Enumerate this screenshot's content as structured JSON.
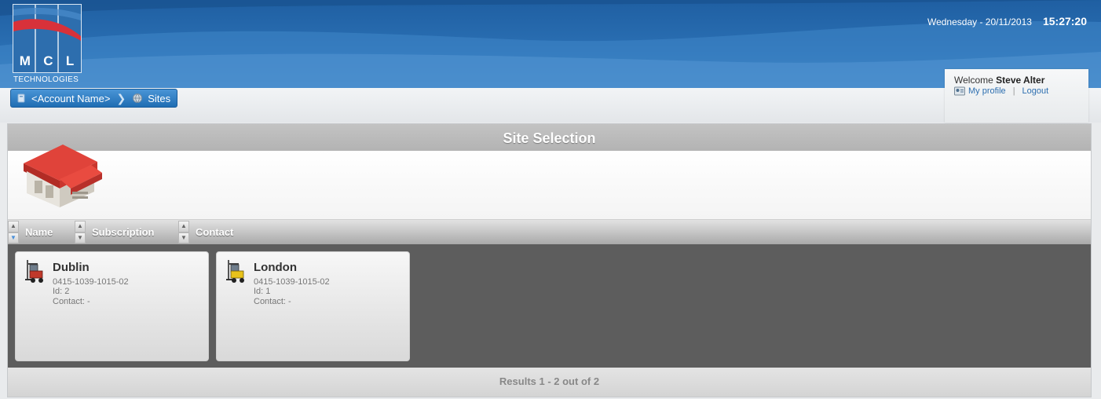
{
  "header": {
    "logo_letters": [
      "M",
      "C",
      "L"
    ],
    "logo_subtitle": "TECHNOLOGIES",
    "date": "Wednesday - 20/11/2013",
    "time": "15:27:20"
  },
  "breadcrumb": {
    "items": [
      {
        "label": "<Account Name>",
        "icon": "account-icon"
      },
      {
        "label": "Sites",
        "icon": "globe-icon"
      }
    ]
  },
  "user": {
    "welcome_prefix": "Welcome",
    "name": "Steve Alter",
    "profile_link": "My profile",
    "logout_link": "Logout"
  },
  "panel": {
    "title": "Site Selection",
    "sort_columns": [
      "Name",
      "Subscription",
      "Contact"
    ],
    "footer": "Results 1 - 2 out of 2"
  },
  "sites": [
    {
      "name": "Dublin",
      "subscription": "0415-1039-1015-02",
      "id": "Id: 2",
      "contact": "Contact: -",
      "icon": "forklift-icon",
      "accent": "#c0392b"
    },
    {
      "name": "London",
      "subscription": "0415-1039-1015-02",
      "id": "Id: 1",
      "contact": "Contact: -",
      "icon": "forklift-icon",
      "accent": "#e8c21a"
    }
  ],
  "colors": {
    "header_blue": "#2a6fb3",
    "breadcrumb_blue": "#1f6db3",
    "cards_background": "#5d5d5d"
  }
}
